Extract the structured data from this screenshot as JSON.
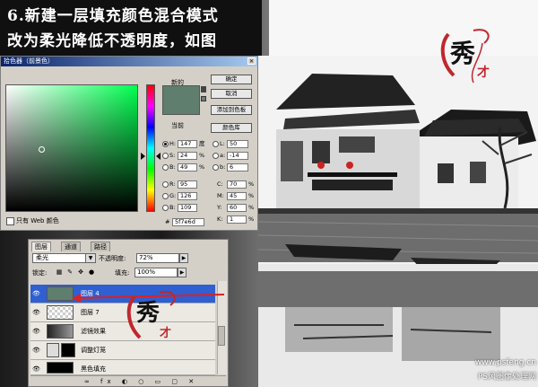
{
  "caption": {
    "line1": "6.新建一层填充颜色混合模式",
    "line2": "改为柔光降低不透明度，如图"
  },
  "picker": {
    "title": "拾色器（前景色）",
    "new_label": "新的",
    "current_label": "当前",
    "new_color": "#5f7e6d",
    "buttons": {
      "ok": "确定",
      "cancel": "取消",
      "add_swatch": "添加到色板",
      "color_library": "颜色库"
    },
    "web_only": "只有 Web 颜色",
    "fields": {
      "H": {
        "label": "H:",
        "value": "147",
        "unit": "度"
      },
      "S": {
        "label": "S:",
        "value": "24",
        "unit": "%"
      },
      "B": {
        "label": "B:",
        "value": "49",
        "unit": "%"
      },
      "R": {
        "label": "R:",
        "value": "95"
      },
      "G": {
        "label": "G:",
        "value": "126"
      },
      "Bv": {
        "label": "B:",
        "value": "109"
      },
      "L": {
        "label": "L:",
        "value": "50"
      },
      "a": {
        "label": "a:",
        "value": "-14"
      },
      "b": {
        "label": "b:",
        "value": "6"
      },
      "C": {
        "label": "C:",
        "value": "70",
        "unit": "%"
      },
      "M": {
        "label": "M:",
        "value": "45",
        "unit": "%"
      },
      "Y": {
        "label": "Y:",
        "value": "60",
        "unit": "%"
      },
      "K": {
        "label": "K:",
        "value": "1",
        "unit": "%"
      },
      "hex": {
        "label": "#",
        "value": "5f7e6d"
      }
    }
  },
  "layers": {
    "tabs": [
      "图层",
      "通道",
      "路径"
    ],
    "blend_mode": "柔光",
    "opacity_label": "不透明度:",
    "opacity": "72%",
    "lock_label": "锁定:",
    "fill_label": "填充:",
    "fill": "100%",
    "rows": [
      {
        "name": "图层 4",
        "selected": true,
        "thumb": "#5f7e6d"
      },
      {
        "name": "图层 7",
        "selected": false,
        "thumb": "#e8e8e8"
      },
      {
        "name": "滤镜效果",
        "selected": false,
        "thumb": "#666"
      },
      {
        "name": "调整灯笼",
        "selected": false,
        "thumb": "#ddd"
      },
      {
        "name": "黑色填充",
        "selected": false,
        "thumb": "#000"
      }
    ],
    "bottom_icons": "∞ fx ◐ ○ ▭ ▢ ✕"
  },
  "logo": {
    "char": "秀",
    "sub": "才"
  },
  "watermark": {
    "url": "www.psfeng.cn",
    "name": "PS风图像处理网"
  }
}
